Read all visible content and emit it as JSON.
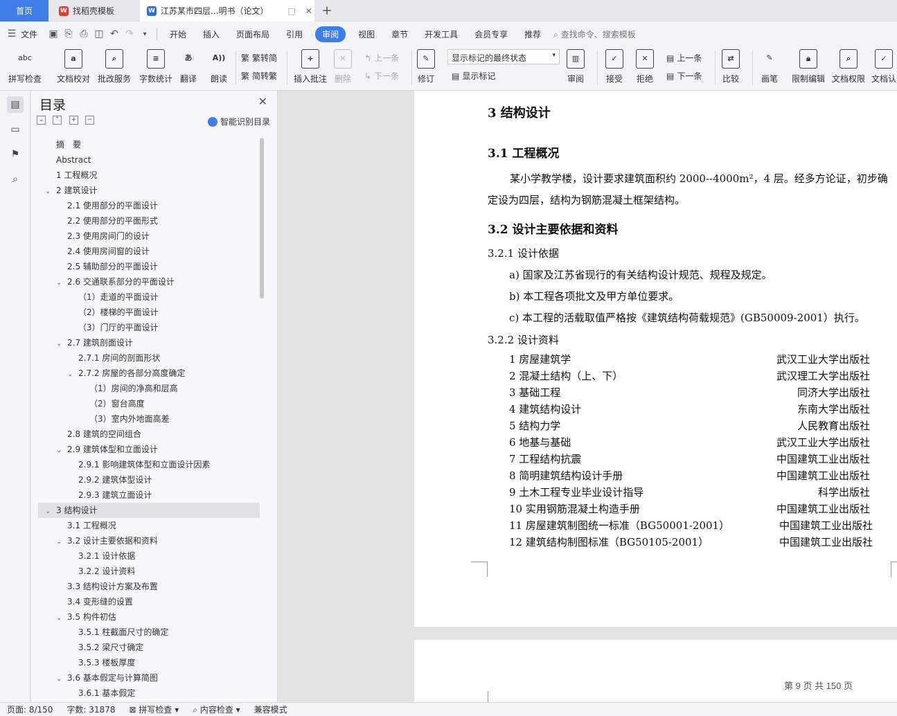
{
  "tabs": {
    "home": "首页",
    "template": "找稻壳模板",
    "doc": "江苏某市四层...明书（论文）"
  },
  "menubar": {
    "file": "文件",
    "items": [
      "开始",
      "插入",
      "页面布局",
      "引用",
      "审阅",
      "视图",
      "章节",
      "开发工具",
      "会员专享",
      "推荐"
    ],
    "active": "审阅",
    "search": "查找命令、搜索模板"
  },
  "ribbon": {
    "spell_check": "拼写检查",
    "doc_proofread": "文档校对",
    "revise_service": "批改服务",
    "word_count": "字数统计",
    "translate": "翻译",
    "read_aloud": "朗读",
    "to_traditional": "繁转简",
    "to_simplified": "简转繁",
    "insert_comment": "插入批注",
    "delete": "删除",
    "prev": "上一条",
    "next": "下一条",
    "revision": "修订",
    "markup_state": "显示标记的最终状态",
    "show_markup": "显示标记",
    "review": "审阅",
    "accept": "接受",
    "reject": "拒绝",
    "prev2": "上一条",
    "next2": "下一条",
    "compare": "比较",
    "pen": "画笔",
    "restrict_edit": "限制编辑",
    "doc_permission": "文档权限",
    "doc_auth": "文档认"
  },
  "toc": {
    "title": "目录",
    "smart": "智能识别目录",
    "items": [
      {
        "text": "摘　要",
        "level": 0,
        "chev": ""
      },
      {
        "text": "Abstract",
        "level": 0,
        "chev": ""
      },
      {
        "text": "1 工程概况",
        "level": 0,
        "chev": ""
      },
      {
        "text": "2 建筑设计",
        "level": 0,
        "chev": "v"
      },
      {
        "text": "2.1 使用部分的平面设计",
        "level": 1,
        "chev": ""
      },
      {
        "text": "2.2 使用部分的平面形式",
        "level": 1,
        "chev": ""
      },
      {
        "text": "2.3 使用房间门的设计",
        "level": 1,
        "chev": ""
      },
      {
        "text": "2.4  使用房间窗的设计",
        "level": 1,
        "chev": ""
      },
      {
        "text": "2.5  辅助部分的平面设计",
        "level": 1,
        "chev": ""
      },
      {
        "text": "2.6  交通联系部分的平面设计",
        "level": 1,
        "chev": "v"
      },
      {
        "text": "（1）走道的平面设计",
        "level": 2,
        "chev": ""
      },
      {
        "text": "（2）楼梯的平面设计",
        "level": 2,
        "chev": ""
      },
      {
        "text": "（3）门厅的平面设计",
        "level": 2,
        "chev": ""
      },
      {
        "text": "2.7  建筑剖面设计",
        "level": 1,
        "chev": "v"
      },
      {
        "text": "2.7.1 房间的剖面形状",
        "level": 2,
        "chev": ""
      },
      {
        "text": "2.7.2 房屋的各部分高度确定",
        "level": 2,
        "chev": "v"
      },
      {
        "text": "（1）房间的净高和层高",
        "level": 3,
        "chev": ""
      },
      {
        "text": "（2）窗台高度",
        "level": 3,
        "chev": ""
      },
      {
        "text": "（3）室内外地面高差",
        "level": 3,
        "chev": ""
      },
      {
        "text": "2.8 建筑的空间组合",
        "level": 1,
        "chev": ""
      },
      {
        "text": "2.9  建筑体型和立面设计",
        "level": 1,
        "chev": "v"
      },
      {
        "text": "2.9.1  影响建筑体型和立面设计因素",
        "level": 2,
        "chev": ""
      },
      {
        "text": "2.9.2  建筑体型设计",
        "level": 2,
        "chev": ""
      },
      {
        "text": "2.9.3  建筑立面设计",
        "level": 2,
        "chev": ""
      },
      {
        "text": "3  结构设计",
        "level": 0,
        "chev": "v",
        "selected": true
      },
      {
        "text": "3.1  工程概况",
        "level": 1,
        "chev": ""
      },
      {
        "text": "3.2    设计主要依据和资料",
        "level": 1,
        "chev": "v"
      },
      {
        "text": "3.2.1    设计依据",
        "level": 2,
        "chev": ""
      },
      {
        "text": "3.2.2    设计资料",
        "level": 2,
        "chev": ""
      },
      {
        "text": "3.3  结构设计方案及布置",
        "level": 1,
        "chev": ""
      },
      {
        "text": "3.4 变形缝的设置",
        "level": 1,
        "chev": ""
      },
      {
        "text": "3.5    构件初估",
        "level": 1,
        "chev": "v"
      },
      {
        "text": "3.5.1    柱截面尺寸的确定",
        "level": 2,
        "chev": ""
      },
      {
        "text": "3.5.2    梁尺寸确定",
        "level": 2,
        "chev": ""
      },
      {
        "text": "3.5.3    楼板厚度",
        "level": 2,
        "chev": ""
      },
      {
        "text": "3.6    基本假定与计算简图",
        "level": 1,
        "chev": "v"
      },
      {
        "text": "3.6.1    基本假定",
        "level": 2,
        "chev": ""
      }
    ]
  },
  "doc": {
    "h_chapter": "3  结构设计",
    "h_31": "3.1  工程概况",
    "p_31a": "某小学教学楼，设计要求建筑面积约 2000--4000m²，4 层。经多方论证，初步确",
    "p_31b": "定设为四层，结构为钢筋混凝土框架结构。",
    "h_32": "3.2    设计主要依据和资料",
    "h_321": "3.2.1    设计依据",
    "basis": [
      "a)    国家及江苏省现行的有关结构设计规范、规程及规定。",
      "b)    本工程各项批文及甲方单位要求。",
      "c)    本工程的活载取值严格按《建筑结构荷载规范》(GB50009-2001）执行。"
    ],
    "h_322": "3.2.2    设计资料",
    "refs": [
      {
        "title": "1  房屋建筑学",
        "pub": "武汉工业大学出版社"
      },
      {
        "title": "2  混凝土结构（上、下）",
        "pub": "武汉理工大学出版社"
      },
      {
        "title": "3  基础工程",
        "pub": "同济大学出版社"
      },
      {
        "title": "4  建筑结构设计",
        "pub": "东南大学出版社"
      },
      {
        "title": "5  结构力学",
        "pub": "人民教育出版社"
      },
      {
        "title": "6  地基与基础",
        "pub": "武汉工业大学出版社"
      },
      {
        "title": "7  工程结构抗震",
        "pub": "中国建筑工业出版社"
      },
      {
        "title": "8  简明建筑结构设计手册",
        "pub": "中国建筑工业出版社"
      },
      {
        "title": "9  土木工程专业毕业设计指导",
        "pub": "科学出版社"
      },
      {
        "title": "10  实用钢筋混凝土构造手册",
        "pub": "中国建筑工业出版社"
      },
      {
        "title": "11  房屋建筑制图统一标准（BG50001-2001）",
        "pub": "中国建筑工业出版社"
      },
      {
        "title": "12  建筑结构制图标准（BG50105-2001）",
        "pub": "中国建筑工业出版社"
      }
    ],
    "page_note": "第  9  页    共  150  页"
  },
  "status": {
    "page": "页面: 8/150",
    "words": "字数: 31878",
    "spell": "拼写检查",
    "content": "内容检查",
    "compat": "兼容模式"
  }
}
